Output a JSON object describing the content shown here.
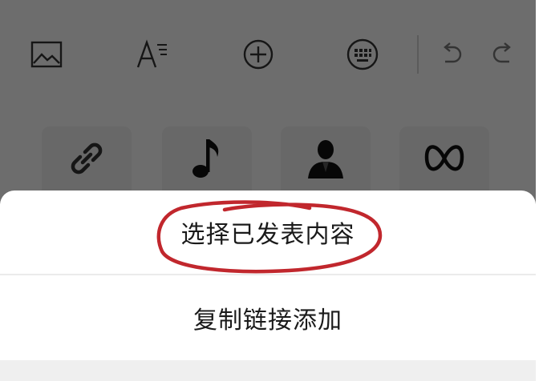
{
  "toolbar": {
    "icons": [
      "image-icon",
      "font-style-icon",
      "add-circle-icon",
      "keyboard-icon",
      "undo-icon",
      "redo-icon"
    ]
  },
  "tiles": {
    "icons": [
      "link-icon",
      "music-note-icon",
      "person-icon",
      "mini-program-icon"
    ]
  },
  "sheet": {
    "option1": "选择已发表内容",
    "option2": "复制链接添加"
  },
  "colors": {
    "overlay": "rgba(0,0,0,0.56)",
    "annotation": "#c1272d",
    "icon": "#333333"
  }
}
